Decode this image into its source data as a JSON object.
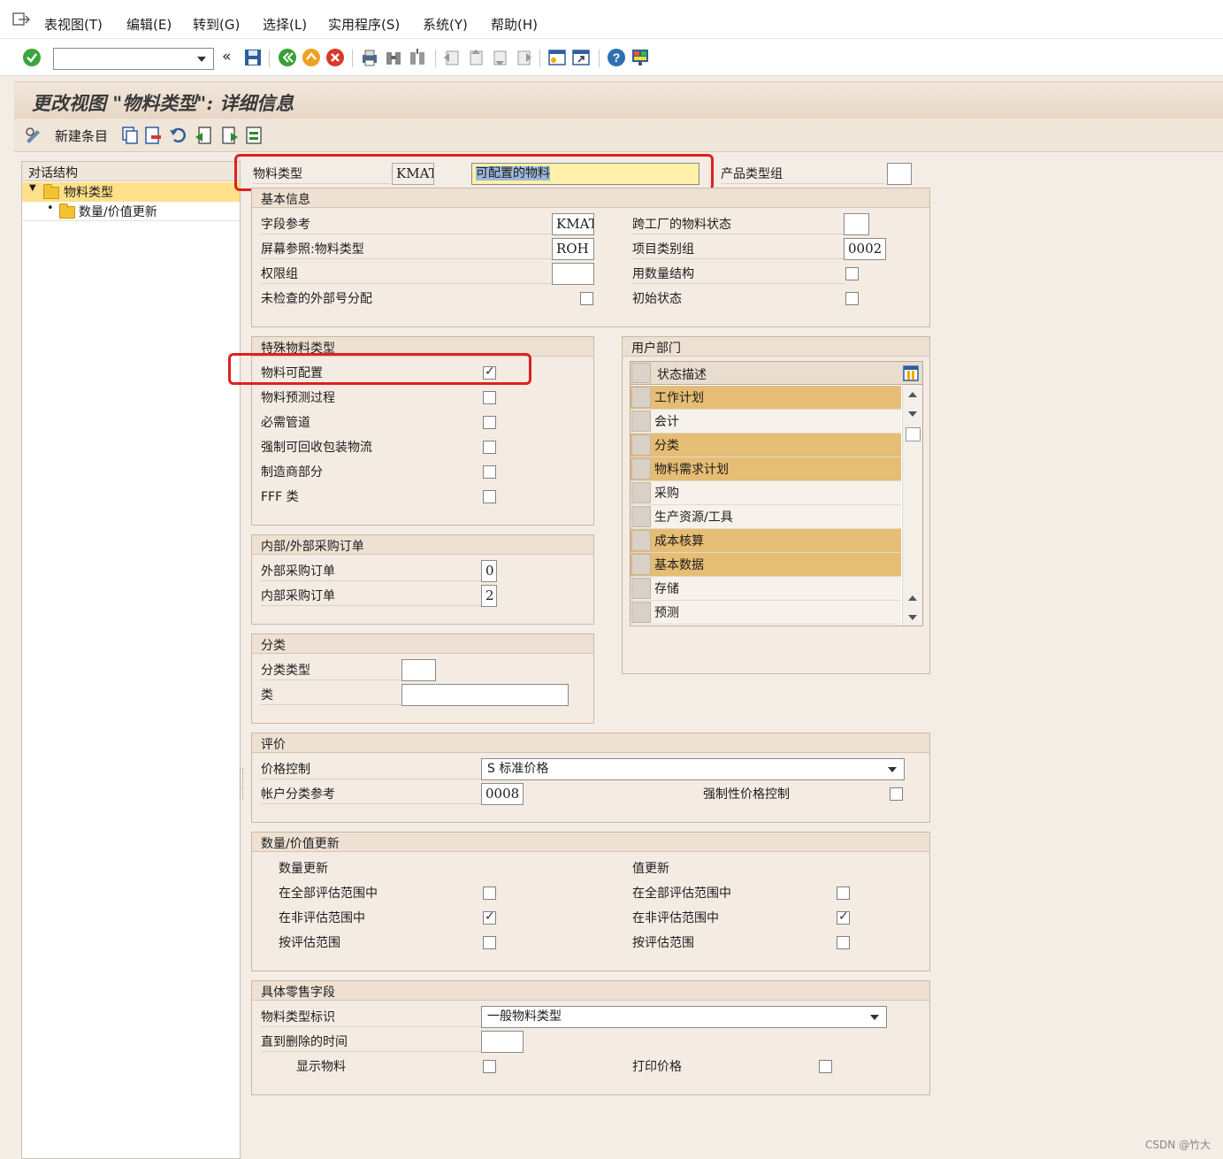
{
  "menu": {
    "items": [
      "表视图(T)",
      "编辑(E)",
      "转到(G)",
      "选择(L)",
      "实用程序(S)",
      "系统(Y)",
      "帮助(H)"
    ]
  },
  "toolbar": {
    "command_field_value": ""
  },
  "title": "更改视图 \"物料类型\": 详细信息",
  "app_toolbar": {
    "new_entries_label": "新建条目"
  },
  "nav": {
    "title": "对话结构",
    "items": [
      {
        "label": "物料类型",
        "selected": true
      },
      {
        "label": "数量/价值更新",
        "selected": false
      }
    ]
  },
  "header": {
    "material_type_label": "物料类型",
    "material_type_code": "KMAT",
    "material_type_desc": "可配置的物料",
    "product_type_group_label": "产品类型组",
    "product_type_group_value": ""
  },
  "basic": {
    "title": "基本信息",
    "field_ref_label": "字段参考",
    "field_ref_value": "KMAT",
    "cross_plant_status_label": "跨工厂的物料状态",
    "cross_plant_status_value": "",
    "screen_ref_label": "屏幕参照:物料类型",
    "screen_ref_value": "ROH",
    "item_cat_group_label": "项目类别组",
    "item_cat_group_value": "0002",
    "auth_group_label": "权限组",
    "auth_group_value": "",
    "qty_structure_label": "用数量结构",
    "qty_structure_checked": false,
    "ext_num_label": "未检查的外部号分配",
    "ext_num_checked": false,
    "initial_status_label": "初始状态",
    "initial_status_checked": false
  },
  "special": {
    "title": "特殊物料类型",
    "items": [
      {
        "label": "物料可配置",
        "checked": true
      },
      {
        "label": "物料预测过程",
        "checked": false
      },
      {
        "label": "必需管道",
        "checked": false
      },
      {
        "label": "强制可回收包装物流",
        "checked": false
      },
      {
        "label": "制造商部分",
        "checked": false
      },
      {
        "label": "FFF 类",
        "checked": false
      }
    ]
  },
  "user_dept": {
    "title": "用户部门",
    "column_header": "状态描述",
    "rows": [
      {
        "label": "工作计划",
        "highlighted": true
      },
      {
        "label": "会计",
        "highlighted": false
      },
      {
        "label": "分类",
        "highlighted": true
      },
      {
        "label": "物料需求计划",
        "highlighted": true
      },
      {
        "label": "采购",
        "highlighted": false
      },
      {
        "label": "生产资源/工具",
        "highlighted": false
      },
      {
        "label": "成本核算",
        "highlighted": true
      },
      {
        "label": "基本数据",
        "highlighted": true
      },
      {
        "label": "存储",
        "highlighted": false
      },
      {
        "label": "预测",
        "highlighted": false
      }
    ]
  },
  "po": {
    "title": "内部/外部采购订单",
    "external_label": "外部采购订单",
    "external_value": "0",
    "internal_label": "内部采购订单",
    "internal_value": "2"
  },
  "classification": {
    "title": "分类",
    "class_type_label": "分类类型",
    "class_type_value": "",
    "class_label": "类",
    "class_value": ""
  },
  "valuation": {
    "title": "评价",
    "price_control_label": "价格控制",
    "price_control_value": "S 标准价格",
    "acct_cat_ref_label": "帐户分类参考",
    "acct_cat_ref_value": "0008",
    "forced_price_control_label": "强制性价格控制",
    "forced_price_control_checked": false
  },
  "qty_value": {
    "title": "数量/价值更新",
    "qty_header": "数量更新",
    "value_header": "值更新",
    "rows": [
      {
        "label": "在全部评估范围中",
        "qty_checked": false,
        "value_checked": false
      },
      {
        "label": "在非评估范围中",
        "qty_checked": true,
        "value_checked": true
      },
      {
        "label": "按评估范围",
        "qty_checked": false,
        "value_checked": false
      }
    ]
  },
  "retail": {
    "title": "具体零售字段",
    "mat_type_id_label": "物料类型标识",
    "mat_type_id_value": "一般物料类型",
    "time_to_delete_label": "直到删除的时间",
    "time_to_delete_value": "",
    "display_material_label": "显示物料",
    "display_material_checked": false,
    "print_price_label": "打印价格",
    "print_price_checked": false
  },
  "colors": {
    "accent_highlight": "#e02020",
    "row_highlight": "#e6bd74",
    "nav_selected": "#ffe08a",
    "desc_field": "#fff1a8"
  },
  "watermark": "CSDN @竹大"
}
